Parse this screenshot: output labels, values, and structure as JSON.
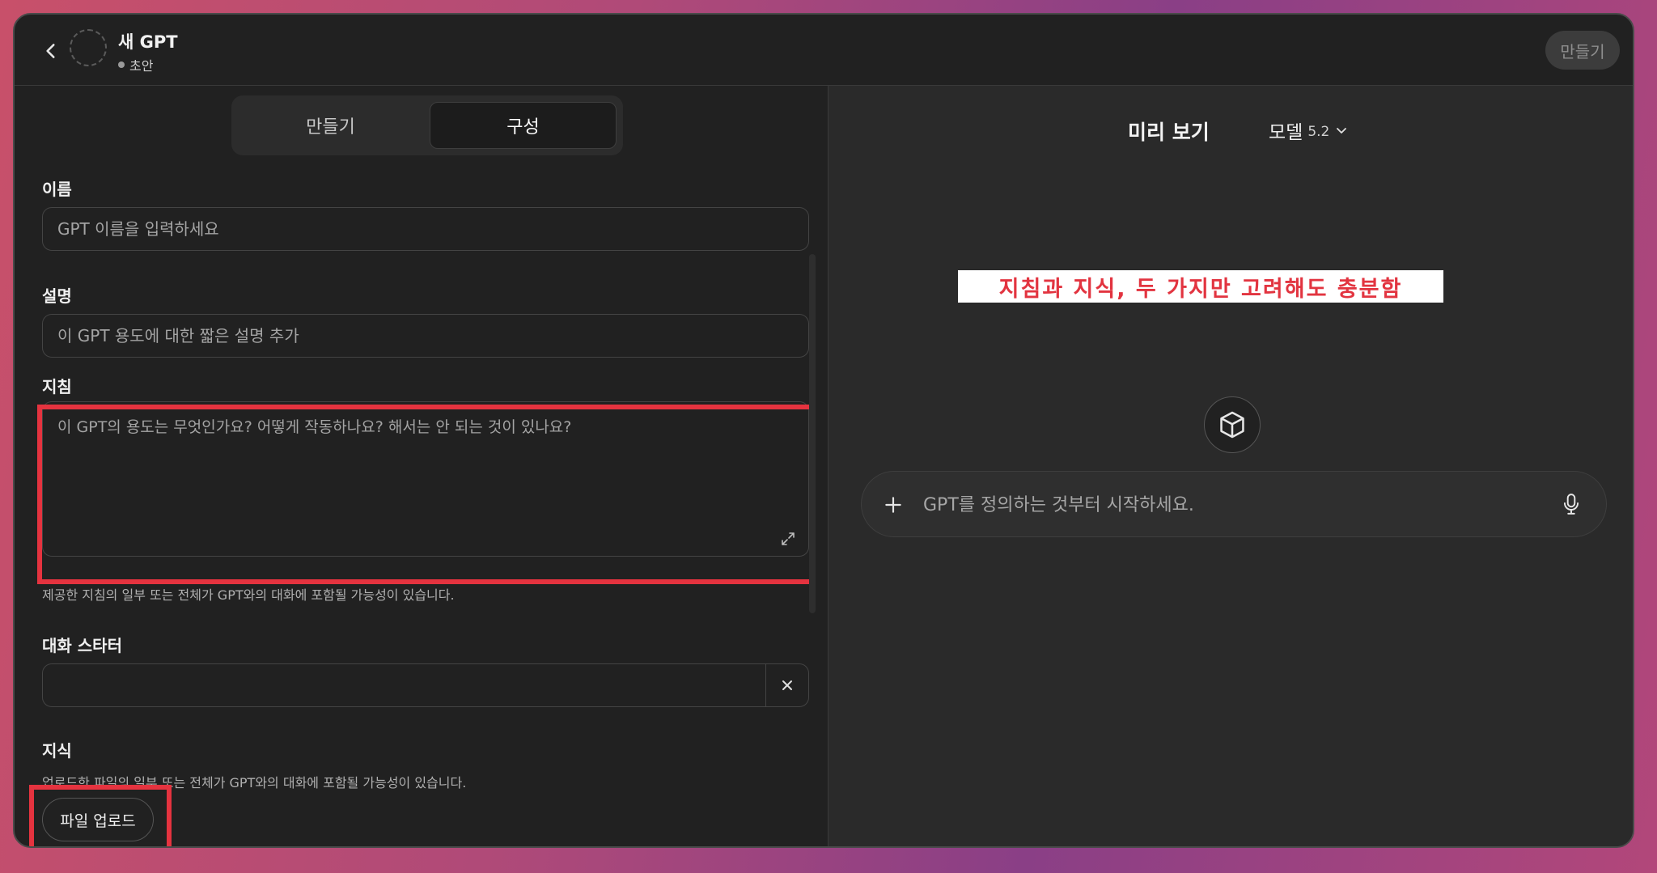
{
  "header": {
    "title": "새 GPT",
    "status": "초안",
    "create_button": "만들기"
  },
  "tabs": [
    {
      "label": "만들기",
      "active": false
    },
    {
      "label": "구성",
      "active": true
    }
  ],
  "form": {
    "name": {
      "label": "이름",
      "placeholder": "GPT 이름을 입력하세요",
      "value": ""
    },
    "description": {
      "label": "설명",
      "placeholder": "이 GPT 용도에 대한 짧은 설명 추가",
      "value": ""
    },
    "instructions": {
      "label": "지침",
      "placeholder": "이 GPT의 용도는 무엇인가요? 어떻게 작동하나요? 해서는 안 되는 것이 있나요?",
      "value": "",
      "helper": "제공한 지침의 일부 또는 전체가 GPT와의 대화에 포함될 가능성이 있습니다."
    },
    "starters": {
      "label": "대화 스타터",
      "value": ""
    },
    "knowledge": {
      "label": "지식",
      "helper": "업로드한 파일의 일부 또는 전체가 GPT와의 대화에 포함될 가능성이 있습니다.",
      "upload_button": "파일 업로드"
    }
  },
  "preview": {
    "title": "미리 보기",
    "model_label": "모델",
    "model_version": "5.2",
    "annotation": "지침과 지식, 두 가지만 고려해도 충분함",
    "chat_placeholder": "GPT를 정의하는 것부터 시작하세요."
  },
  "colors": {
    "highlight_border": "#e5333f",
    "annotation_text": "#e23440",
    "background": "#212121"
  }
}
